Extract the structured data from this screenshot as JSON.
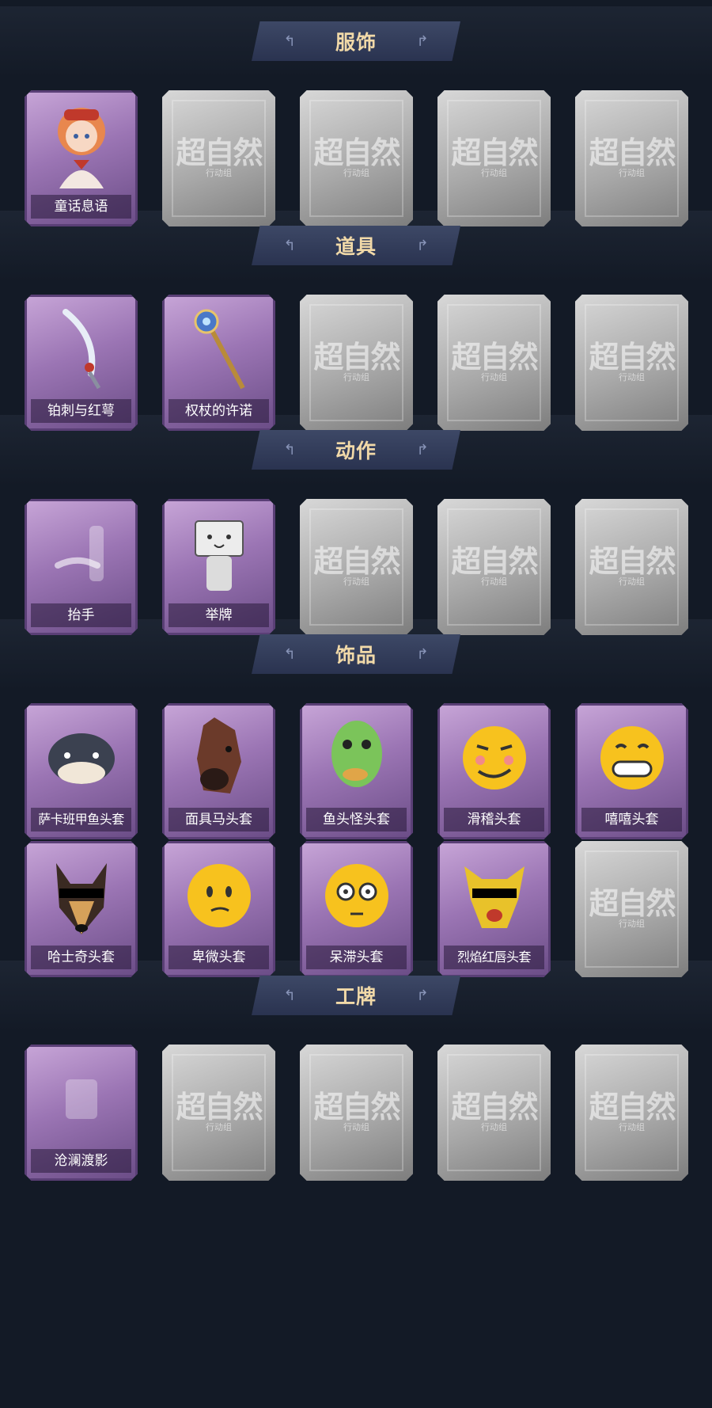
{
  "sections": [
    {
      "title": "服饰",
      "items": [
        "童话息语",
        "",
        "",
        "",
        ""
      ]
    },
    {
      "title": "道具",
      "items": [
        "铂刺与红萼",
        "权杖的许诺",
        "",
        "",
        ""
      ]
    },
    {
      "title": "动作",
      "items": [
        "抬手",
        "举牌",
        "",
        "",
        ""
      ]
    },
    {
      "title": "饰品",
      "items": [
        "萨卡班甲鱼头套",
        "面具马头套",
        "鱼头怪头套",
        "滑稽头套",
        "嘻嘻头套",
        "哈士奇头套",
        "卑微头套",
        "呆滞头套",
        "烈焰红唇头套",
        ""
      ]
    },
    {
      "title": "工牌",
      "items": [
        "沧澜渡影",
        "",
        "",
        "",
        ""
      ]
    }
  ],
  "placeholder": {
    "watermark": "超自然",
    "subtitle": "行动组"
  },
  "colors": {
    "background": "#131a26",
    "banner": "#2f3956",
    "banner_text": "#f1d9a8",
    "filled_card": "#9b75b4",
    "empty_card": "#a9a9a9"
  },
  "icons": {
    "童话息语": "girl-portrait-icon",
    "铂刺与红萼": "curved-blade-icon",
    "权杖的许诺": "scepter-icon",
    "抬手": "raise-hand-icon",
    "举牌": "hold-sign-icon",
    "萨卡班甲鱼头套": "fish-head-icon",
    "面具马头套": "horse-mask-icon",
    "鱼头怪头套": "green-fish-mask-icon",
    "滑稽头套": "smirk-emoji-icon",
    "嘻嘻头套": "grin-emoji-icon",
    "哈士奇头套": "dog-sunglasses-icon",
    "卑微头套": "humble-emoji-icon",
    "呆滞头套": "dazed-emoji-icon",
    "烈焰红唇头套": "yellow-mask-sunglasses-icon",
    "沧澜渡影": "badge-icon"
  }
}
